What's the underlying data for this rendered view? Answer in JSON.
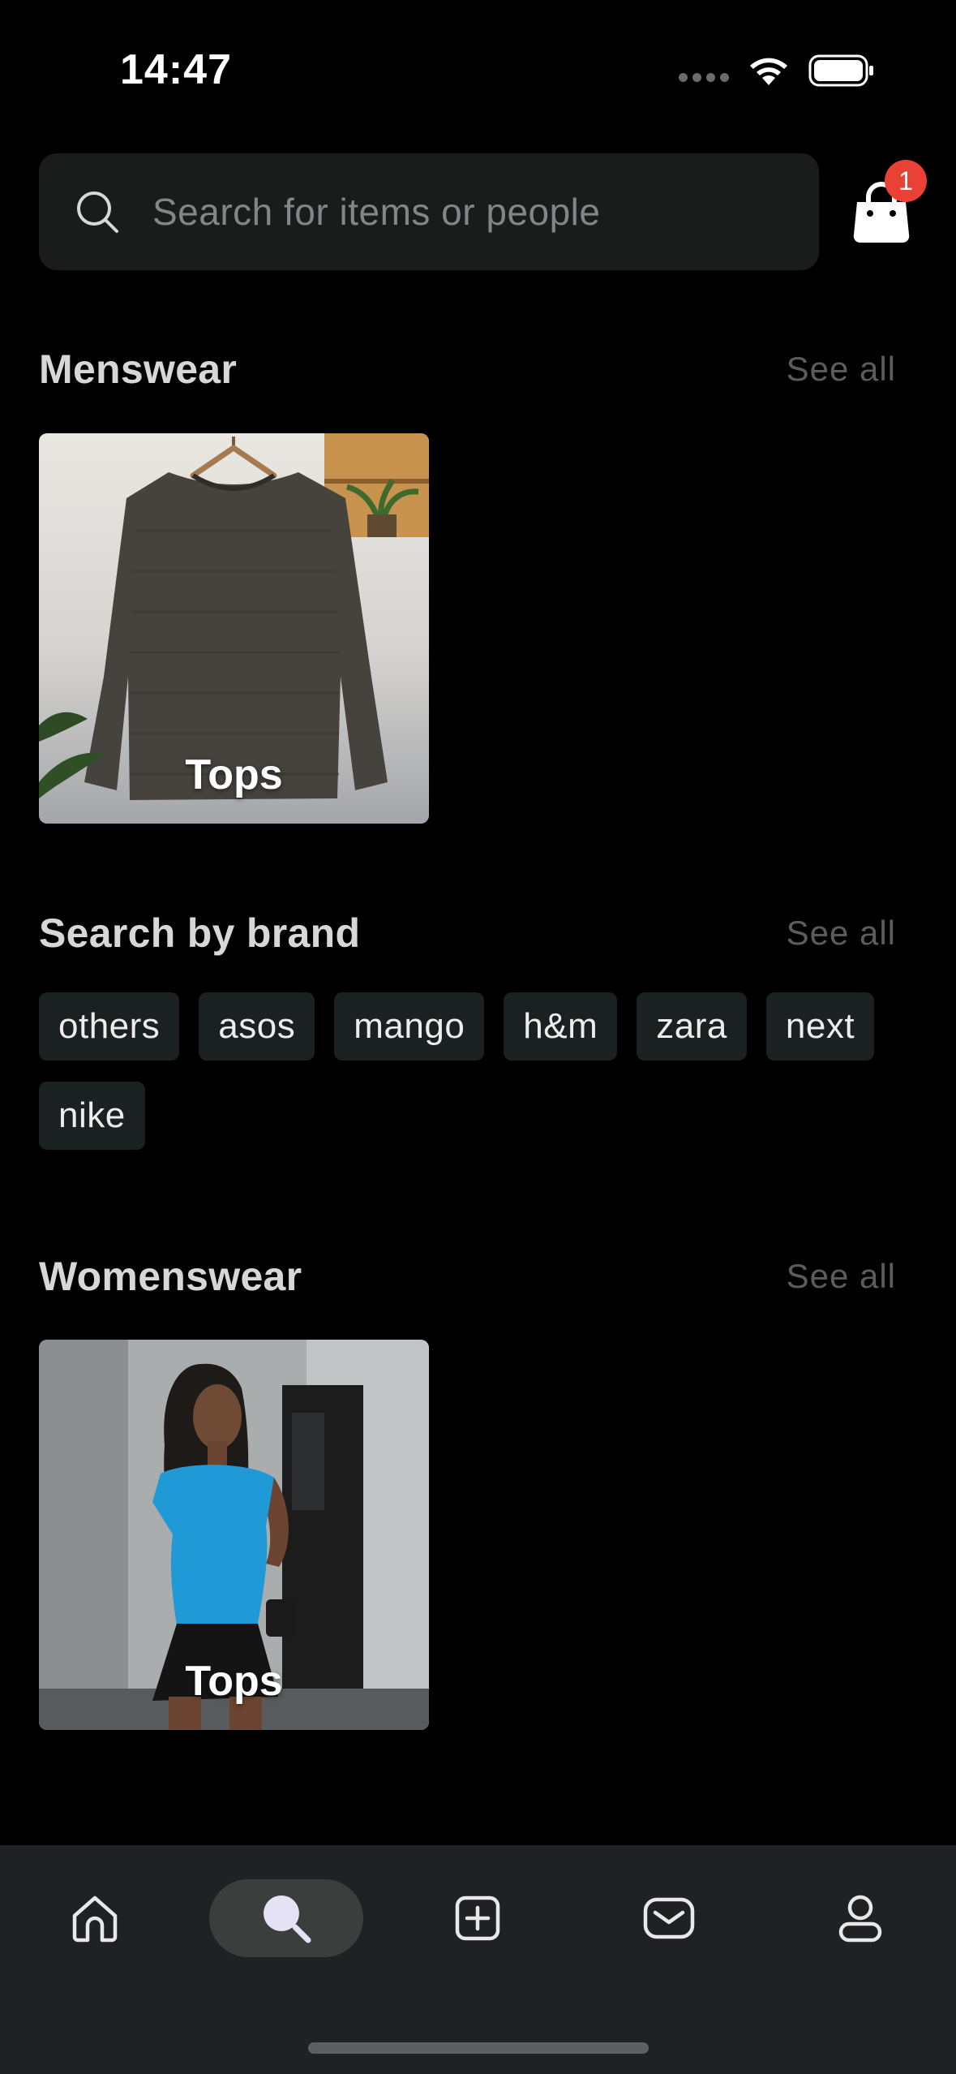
{
  "status_bar": {
    "time": "14:47"
  },
  "search": {
    "placeholder": "Search for items or people"
  },
  "cart": {
    "badge_count": "1"
  },
  "menswear": {
    "title": "Menswear",
    "see_all": "See all",
    "cards": [
      {
        "label": "Tops"
      }
    ]
  },
  "brands": {
    "title": "Search by brand",
    "see_all": "See all",
    "items": [
      "others",
      "asos",
      "mango",
      "h&m",
      "zara",
      "next",
      "nike"
    ]
  },
  "womenswear": {
    "title": "Womenswear",
    "see_all": "See all",
    "cards": [
      {
        "label": "Tops"
      }
    ]
  },
  "tab_bar": {
    "tabs": [
      {
        "icon": "home-icon",
        "active": false
      },
      {
        "icon": "search-icon",
        "active": true
      },
      {
        "icon": "add-listing-icon",
        "active": false
      },
      {
        "icon": "inbox-icon",
        "active": false
      },
      {
        "icon": "profile-icon",
        "active": false
      }
    ]
  },
  "colors": {
    "background": "#000000",
    "surface": "#1a1b1b",
    "chip": "#1b2020",
    "badge": "#e94235",
    "tab_bar": "#202122",
    "active_tab": "#3a3f3e"
  }
}
